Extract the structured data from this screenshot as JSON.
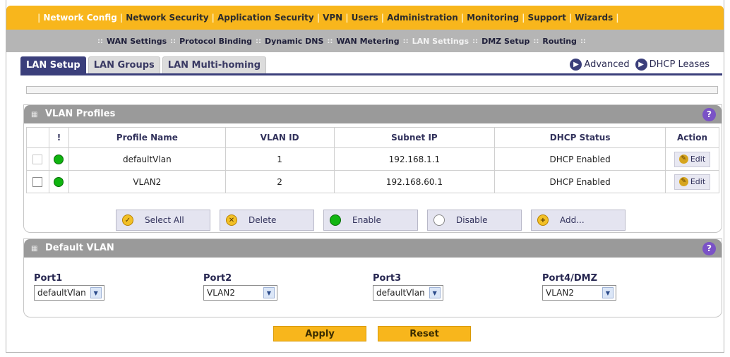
{
  "topnav": {
    "items": [
      {
        "label": "Network Config"
      },
      {
        "label": "Network Security"
      },
      {
        "label": "Application Security"
      },
      {
        "label": "VPN"
      },
      {
        "label": "Users"
      },
      {
        "label": "Administration"
      },
      {
        "label": "Monitoring"
      },
      {
        "label": "Support"
      },
      {
        "label": "Wizards"
      }
    ],
    "active_index": 0
  },
  "subnav": {
    "items": [
      {
        "label": "WAN Settings"
      },
      {
        "label": "Protocol Binding"
      },
      {
        "label": "Dynamic DNS"
      },
      {
        "label": "WAN Metering"
      },
      {
        "label": "LAN Settings"
      },
      {
        "label": "DMZ Setup"
      },
      {
        "label": "Routing"
      }
    ],
    "active_index": 4
  },
  "tabs": [
    {
      "label": "LAN Setup"
    },
    {
      "label": "LAN Groups"
    },
    {
      "label": "LAN Multi-homing"
    }
  ],
  "links": {
    "advanced": "Advanced",
    "dhcp_leases": "DHCP Leases"
  },
  "progress_fraction": 0,
  "vlan_profiles": {
    "title": "VLAN Profiles",
    "columns": {
      "status": "!",
      "profile_name": "Profile Name",
      "vlan_id": "VLAN ID",
      "subnet_ip": "Subnet IP",
      "dhcp_status": "DHCP Status",
      "action": "Action"
    },
    "rows": [
      {
        "profile_name": "defaultVlan",
        "vlan_id": "1",
        "subnet_ip": "192.168.1.1",
        "dhcp_status": "DHCP Enabled",
        "action": "Edit"
      },
      {
        "profile_name": "VLAN2",
        "vlan_id": "2",
        "subnet_ip": "192.168.60.1",
        "dhcp_status": "DHCP Enabled",
        "action": "Edit"
      }
    ]
  },
  "actions": {
    "select_all": "Select All",
    "delete": "Delete",
    "enable": "Enable",
    "disable": "Disable",
    "add": "Add..."
  },
  "default_vlan": {
    "title": "Default VLAN",
    "ports": [
      {
        "label": "Port1",
        "value": "defaultVlan"
      },
      {
        "label": "Port2",
        "value": "VLAN2"
      },
      {
        "label": "Port3",
        "value": "defaultVlan"
      },
      {
        "label": "Port4/DMZ",
        "value": "VLAN2"
      }
    ]
  },
  "buttons": {
    "apply": "Apply",
    "reset": "Reset"
  },
  "colors": {
    "menu_orange": "#f8b61c",
    "tab_navy": "#3b3f7b",
    "status_green": "#0fb40f",
    "help_purple": "#7a52c6"
  }
}
